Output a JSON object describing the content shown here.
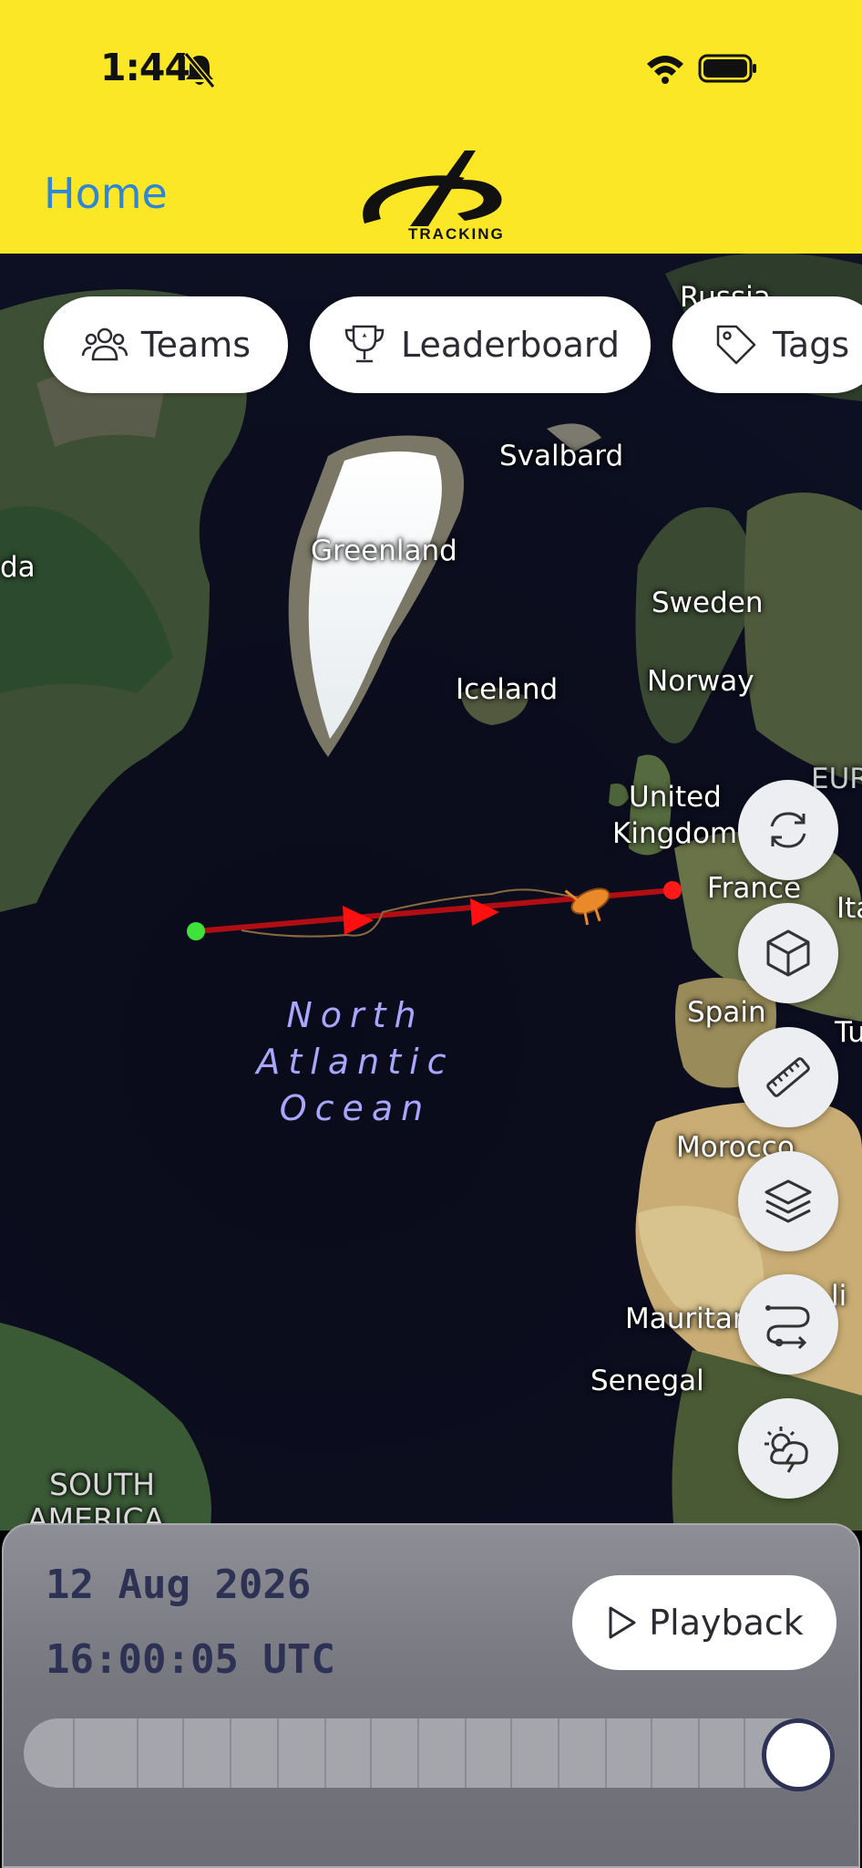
{
  "status_bar": {
    "time": "1:44",
    "icons": [
      "bell-slash-icon",
      "wifi-icon",
      "battery-icon"
    ]
  },
  "header": {
    "back_label": "Home",
    "logo_text": "TRACKING",
    "background": "#fbe726",
    "accent": "#2f86d6"
  },
  "filters": [
    {
      "label": "Teams",
      "icon": "people-icon"
    },
    {
      "label": "Leaderboard",
      "icon": "trophy-icon"
    },
    {
      "label": "Tags",
      "icon": "tag-icon"
    }
  ],
  "map": {
    "labels": {
      "russia": "Russia",
      "svalbard": "Svalbard",
      "canada_partial": "da",
      "greenland": "Greenland",
      "sweden": "Sweden",
      "iceland": "Iceland",
      "norway": "Norway",
      "europe_partial": "EUR",
      "uk_line1": "United",
      "uk_line2": "Kingdom",
      "france": "France",
      "italy_partial": "Ita",
      "spain": "Spain",
      "turkey_partial": "Tu",
      "morocco": "Morocco",
      "mali_partial": "li",
      "mauritania": "Mauritania",
      "senegal": "Senegal",
      "south_america_1": "SOUTH",
      "south_america_2": "AMERICA"
    },
    "ocean": [
      "North",
      "Atlantic",
      "Ocean"
    ],
    "route_color": "#b20d12",
    "start_color": "#3ee23a",
    "finish_color": "#ff1a1a",
    "boat_color": "#e88a2a"
  },
  "map_controls": [
    "refresh-icon",
    "cube-3d-icon",
    "ruler-icon",
    "layers-icon",
    "route-icon",
    "weather-icon"
  ],
  "playback": {
    "date": "12 Aug 2026",
    "time": "16:00:05 UTC",
    "button_label": "Playback",
    "progress": 1.0
  }
}
